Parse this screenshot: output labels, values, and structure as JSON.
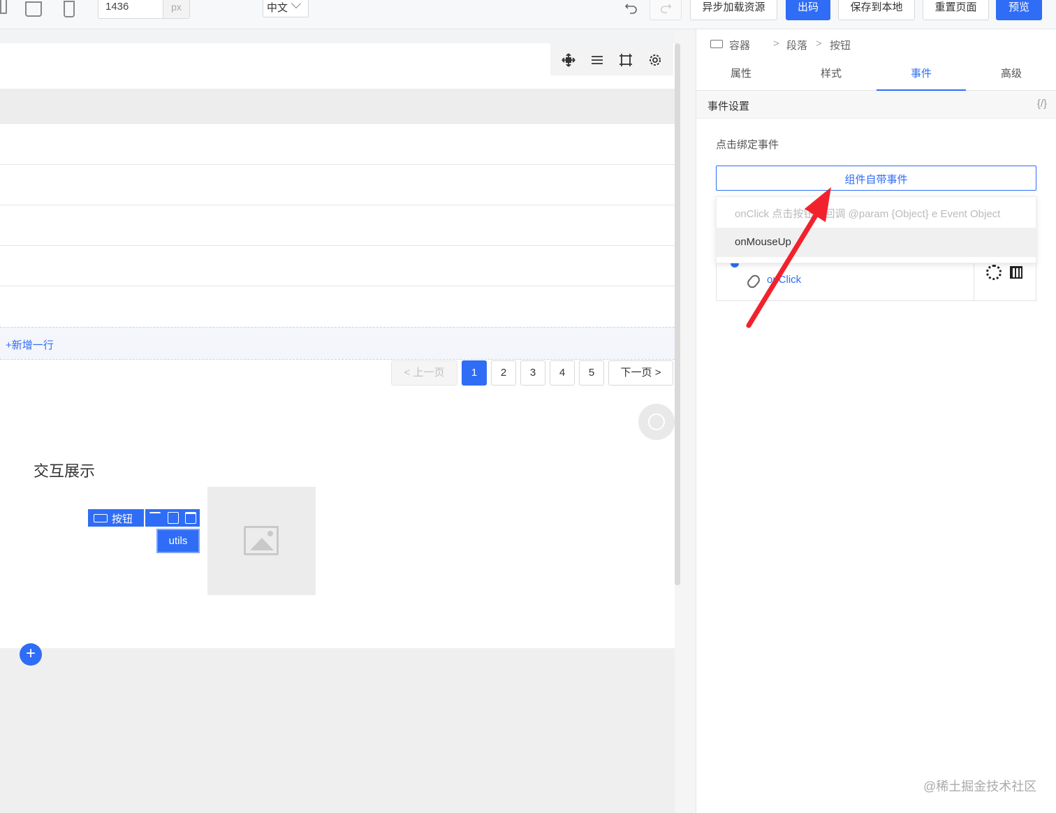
{
  "toolbar": {
    "width_value": "1436",
    "width_unit": "px",
    "language": "中文",
    "buttons": {
      "async_load": "异步加载资源",
      "export_code": "出码",
      "save_local": "保存到本地",
      "reset_page": "重置页面",
      "preview": "预览"
    }
  },
  "canvas": {
    "add_row": "+新增一行",
    "pagination": {
      "prev": "上一页",
      "pages": [
        "1",
        "2",
        "3",
        "4",
        "5"
      ],
      "active_page": "1",
      "next": "下一页"
    },
    "section_title": "交互展示",
    "selected_component": {
      "tag_label": "按钮",
      "button_text": "utils"
    }
  },
  "panel": {
    "breadcrumb": [
      "容器",
      "段落",
      "按钮"
    ],
    "tabs": [
      "属性",
      "样式",
      "事件",
      "高级"
    ],
    "active_tab": "事件",
    "section_title": "事件设置",
    "code_toggle": "{/}",
    "field_label": "点击绑定事件",
    "event_select": "组件自带事件",
    "dropdown_options": [
      "onClick 点击按钮的回调 @param {Object} e Event Object",
      "onMouseUp"
    ],
    "bound_event": "onClick"
  },
  "watermark": "@稀土掘金技术社区",
  "colors": {
    "primary": "#2f6df6",
    "annotation_arrow": "#f2222c"
  }
}
